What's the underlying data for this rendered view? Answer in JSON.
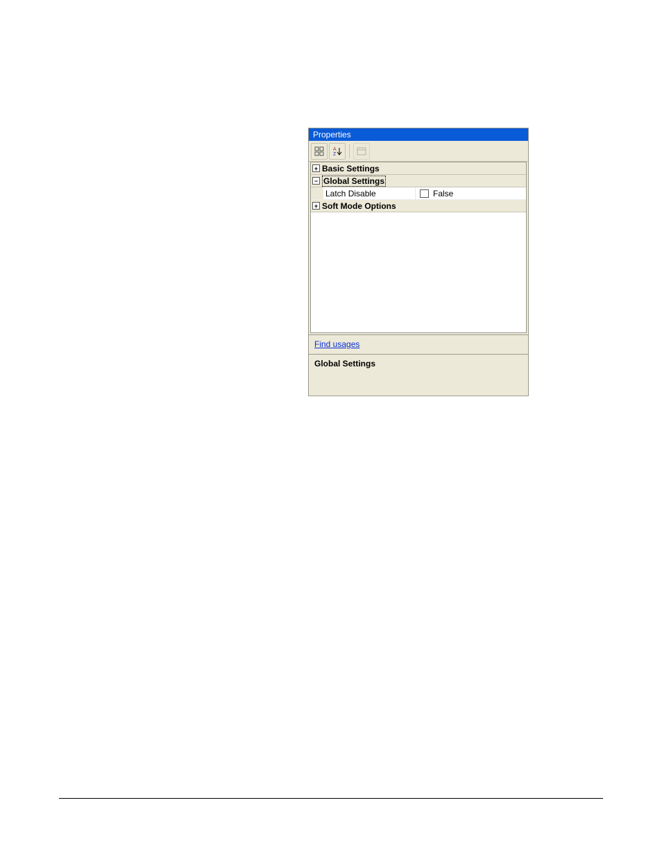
{
  "panel": {
    "title": "Properties",
    "toolbar": {
      "categorized_btn": "⊞⊞",
      "az_btn": "A↓Z",
      "pages_btn": "▭"
    },
    "categories": [
      {
        "name": "Basic Settings",
        "expanded": false,
        "selected": false,
        "items": []
      },
      {
        "name": "Global Settings",
        "expanded": true,
        "selected": true,
        "items": [
          {
            "label": "Latch Disable",
            "value": "False",
            "has_checkbox": true,
            "checked": false
          }
        ]
      },
      {
        "name": "Soft Mode Options",
        "expanded": false,
        "selected": false,
        "items": []
      }
    ],
    "link": "Find usages",
    "description_title": "Global Settings"
  }
}
